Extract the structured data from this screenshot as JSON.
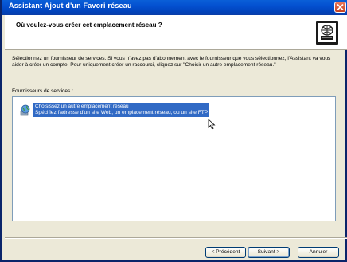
{
  "window": {
    "title": "Assistant Ajout d'un Favori réseau"
  },
  "header": {
    "title": "Où voulez-vous créer cet emplacement réseau ?"
  },
  "intro": {
    "text": "Sélectionnez un fournisseur de services. Si vous n'avez pas d'abonnement avec le fournisseur que vous sélectionnez, l'Assistant va vous aider à créer un compte. Pour uniquement créer un raccourci, cliquez sur \"Choisir un autre emplacement réseau.\""
  },
  "providers": {
    "label": "Fournisseurs de services :",
    "items": [
      {
        "name": "Choisissez un autre emplacement réseau",
        "description": "Spécifiez l'adresse d'un site Web, un emplacement réseau, ou un site FTP",
        "selected": true,
        "icon": "network-globe-icon"
      }
    ]
  },
  "buttons": {
    "back": "< Précédent",
    "next": "Suivant >",
    "cancel": "Annuler"
  },
  "colors": {
    "titlebar": "#0350d0",
    "selection": "#316ac5",
    "dialog_bg": "#ece9d8",
    "close_button": "#c7411e"
  }
}
